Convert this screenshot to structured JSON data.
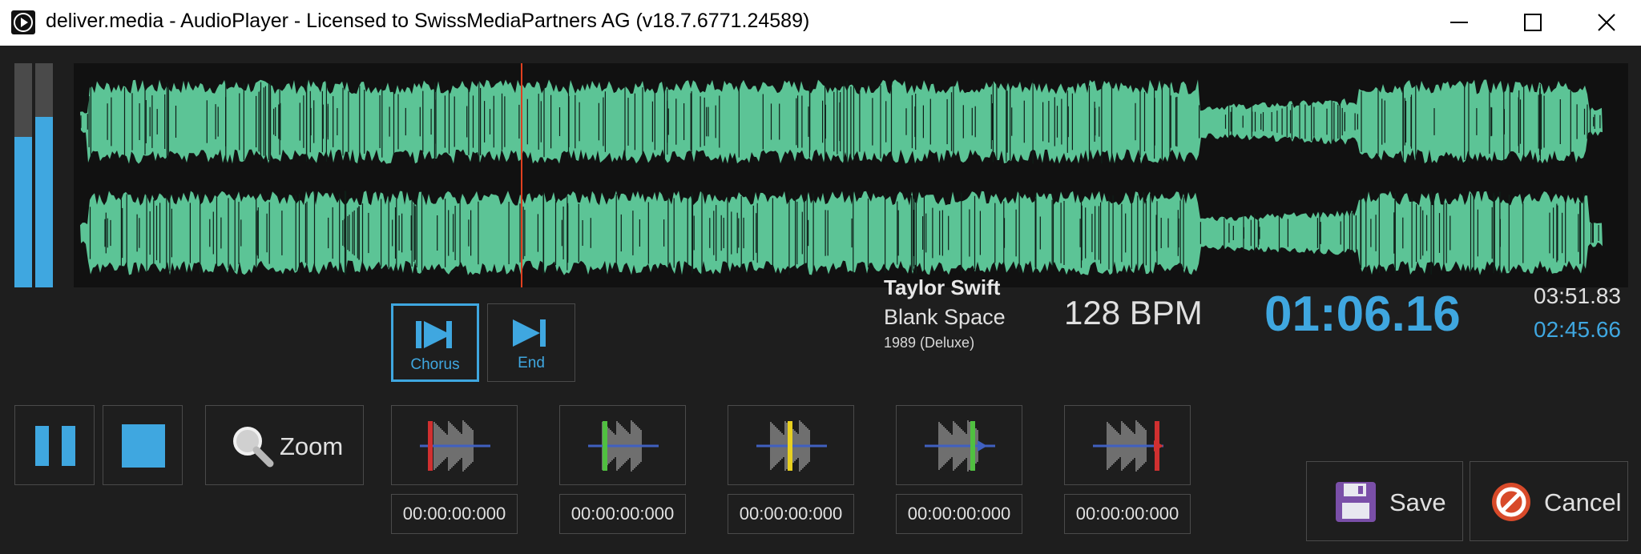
{
  "window": {
    "title": "deliver.media - AudioPlayer - Licensed to SwissMediaPartners AG (v18.7.6771.24589)",
    "controls": [
      "minimize-icon",
      "maximize-icon",
      "close-icon"
    ]
  },
  "meters": {
    "left_level": 0.67,
    "right_level": 0.76
  },
  "waveform": {
    "color": "#5cc496",
    "playhead_color": "#e04020",
    "playhead_fraction": 0.29
  },
  "markers": {
    "chorus_label": "Chorus",
    "end_label": "End"
  },
  "transport": {
    "pause_icon": "pause-icon",
    "stop_icon": "stop-icon",
    "zoom_label": "Zoom"
  },
  "track": {
    "artist": "Taylor Swift",
    "title": "Blank Space",
    "album": "1989 (Deluxe)",
    "bpm": "128 BPM",
    "position": "01:06.16",
    "total": "03:51.83",
    "remaining": "02:45.66"
  },
  "cue_points": [
    {
      "icon": "cue-start-red-icon",
      "color": "#d03030",
      "timecode": "00:00:00:000"
    },
    {
      "icon": "cue-green-icon",
      "color": "#50c040",
      "timecode": "00:00:00:000"
    },
    {
      "icon": "cue-yellow-icon",
      "color": "#e8d020",
      "timecode": "00:00:00:000"
    },
    {
      "icon": "cue-green-arrow-icon",
      "color": "#50c040",
      "timecode": "00:00:00:000"
    },
    {
      "icon": "cue-end-red-icon",
      "color": "#d03030",
      "timecode": "00:00:00:000"
    }
  ],
  "actions": {
    "save_label": "Save",
    "cancel_label": "Cancel"
  },
  "colors": {
    "accent": "#3fa7e0",
    "background": "#1e1e1e"
  }
}
